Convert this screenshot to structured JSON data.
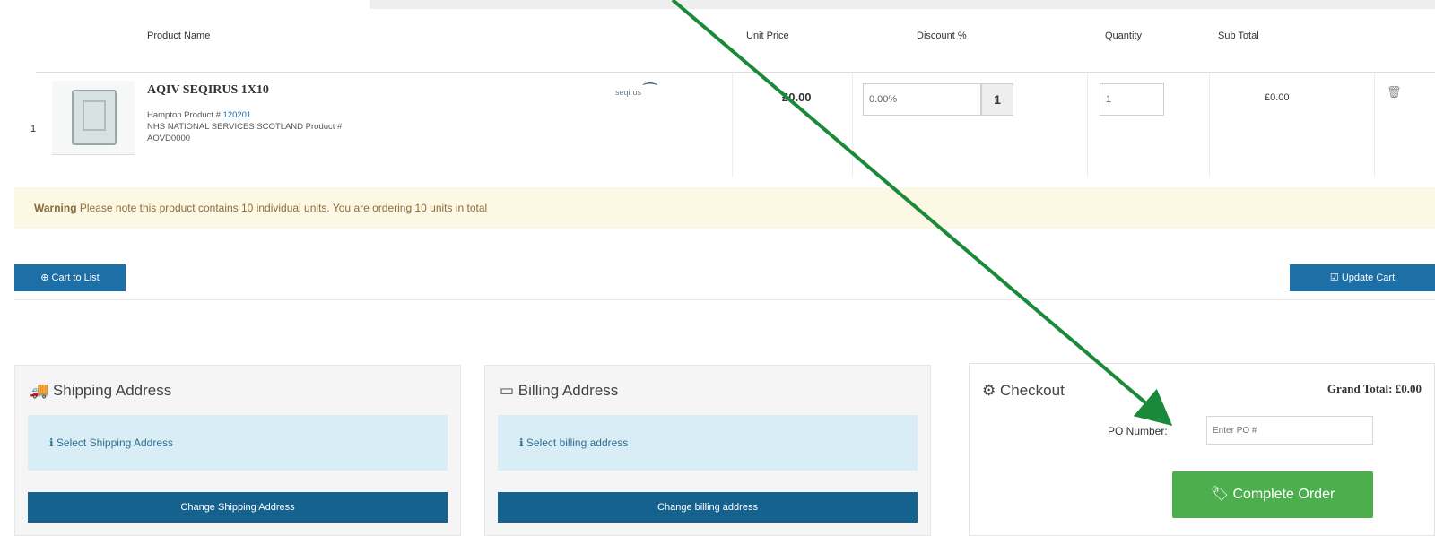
{
  "table": {
    "headers": {
      "product_name": "Product Name",
      "unit_price": "Unit Price",
      "discount": "Discount %",
      "quantity": "Quantity",
      "subtotal": "Sub Total"
    }
  },
  "item": {
    "row_number": "1",
    "name": "AQIV SEQIRUS 1X10",
    "supplier_product_label": "Hampton Product # ",
    "supplier_product_code": "120201",
    "nhs_line": "NHS NATIONAL SERVICES SCOTLAND Product #",
    "nhs_code": "AOVD0000",
    "brand_logo": "seqirus",
    "unit_price": "£0.00",
    "discount_value": "0.00%",
    "discount_button": "1",
    "quantity_value": "1",
    "subtotal": "£0.00"
  },
  "warning": {
    "label": "Warning",
    "text": " Please note this product contains 10 individual units. You are ordering 10 units in total"
  },
  "actions": {
    "cart_to_list": "Cart to List",
    "update_cart": "Update Cart"
  },
  "shipping": {
    "title": "Shipping Address",
    "info": "Select Shipping Address",
    "button": "Change Shipping Address"
  },
  "billing": {
    "title": "Billing Address",
    "info": "Select billing address",
    "button": "Change billing address"
  },
  "checkout": {
    "title": "Checkout",
    "grand_total": "Grand Total: £0.00",
    "po_label": "PO Number:",
    "po_placeholder": "Enter PO #",
    "complete_button": "Complete Order"
  },
  "colors": {
    "primary": "#1d6fa5",
    "success": "#4cae4c",
    "warning_bg": "#fcf8e3",
    "info_bg": "#d9edf7",
    "annotation_arrow": "#1a8a3a"
  },
  "icons": {
    "plus": "plus-circle-icon",
    "update": "check-square-icon",
    "truck": "truck-icon",
    "card": "credit-card-icon",
    "gear": "gear-icon",
    "trash": "trash-icon",
    "tag": "tag-icon",
    "info": "info-icon"
  }
}
